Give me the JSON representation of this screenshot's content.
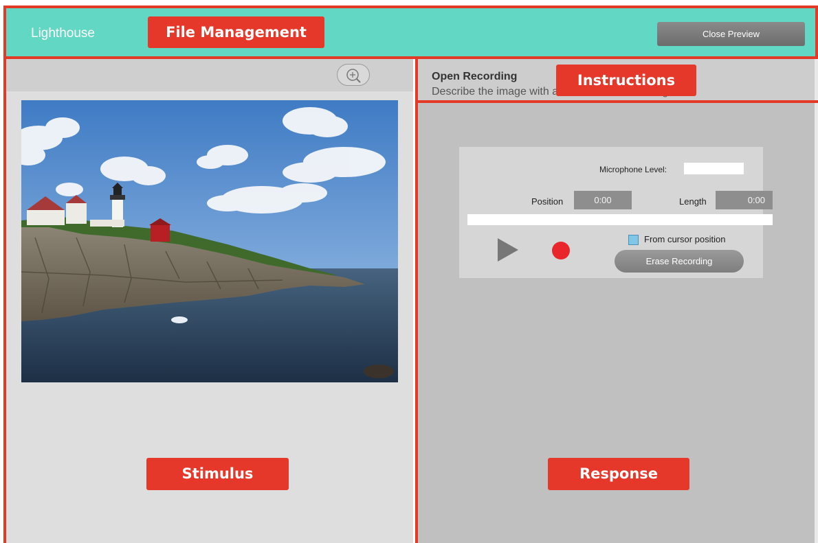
{
  "app": {
    "title": "Lighthouse",
    "close_preview_label": "Close Preview"
  },
  "stimulus": {
    "zoom_icon": "zoom-in-icon",
    "image_subject": "lighthouse on rocky coast"
  },
  "instructions": {
    "title": "Open Recording",
    "text": "Describe the image with a 1 - 2 minute recording."
  },
  "recorder": {
    "mic_level_label": "Microphone Level:",
    "position_label": "Position",
    "position_value": "0:00",
    "length_label": "Length",
    "length_value": "0:00",
    "from_cursor_label": "From cursor position",
    "erase_label": "Erase Recording"
  },
  "annotations": {
    "file_management": "File Management",
    "instructions": "Instructions",
    "stimulus": "Stimulus",
    "response": "Response"
  },
  "colors": {
    "header": "#62d8c4",
    "annotation_red": "#e23a26",
    "record": "#e8262b"
  }
}
